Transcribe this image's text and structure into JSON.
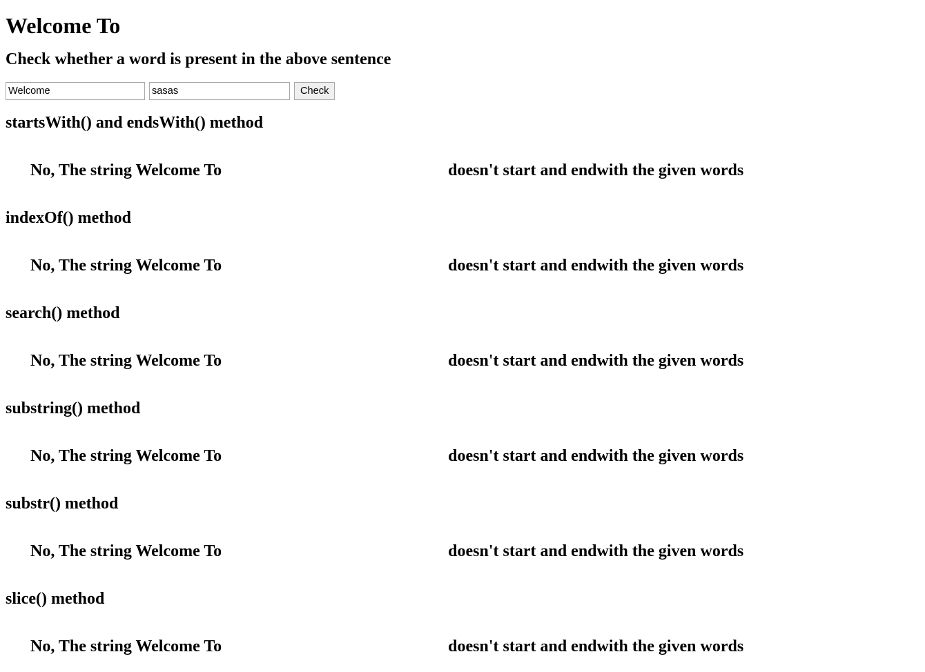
{
  "page": {
    "title": "Welcome To",
    "subtitle": "Check whether a word is present in the above sentence"
  },
  "form": {
    "word_input": {
      "name": "word-input-primary",
      "value": "Welcome",
      "placeholder": ""
    },
    "second_input": {
      "name": "word-input-secondary",
      "value": "sasas",
      "placeholder": ""
    },
    "check_button": {
      "label": "Check"
    }
  },
  "results": [
    {
      "method_heading": "startsWith() and endsWith() method",
      "left_text": "No, The string Welcome To",
      "right_text": "doesn't start and endwith the given words"
    },
    {
      "method_heading": "indexOf() method",
      "left_text": "No, The string Welcome To",
      "right_text": "doesn't start and endwith the given words"
    },
    {
      "method_heading": "search() method",
      "left_text": "No, The string Welcome To",
      "right_text": "doesn't start and endwith the given words"
    },
    {
      "method_heading": "substring() method",
      "left_text": "No, The string Welcome To",
      "right_text": "doesn't start and endwith the given words"
    },
    {
      "method_heading": "substr() method",
      "left_text": "No, The string Welcome To",
      "right_text": "doesn't start and endwith the given words"
    },
    {
      "method_heading": "slice() method",
      "left_text": "No, The string Welcome To",
      "right_text": "doesn't start and endwith the given words"
    }
  ],
  "colors": {
    "text": "#000000",
    "background": "#ffffff",
    "input_border": "#a9a9a9",
    "button_background": "#efefef"
  }
}
